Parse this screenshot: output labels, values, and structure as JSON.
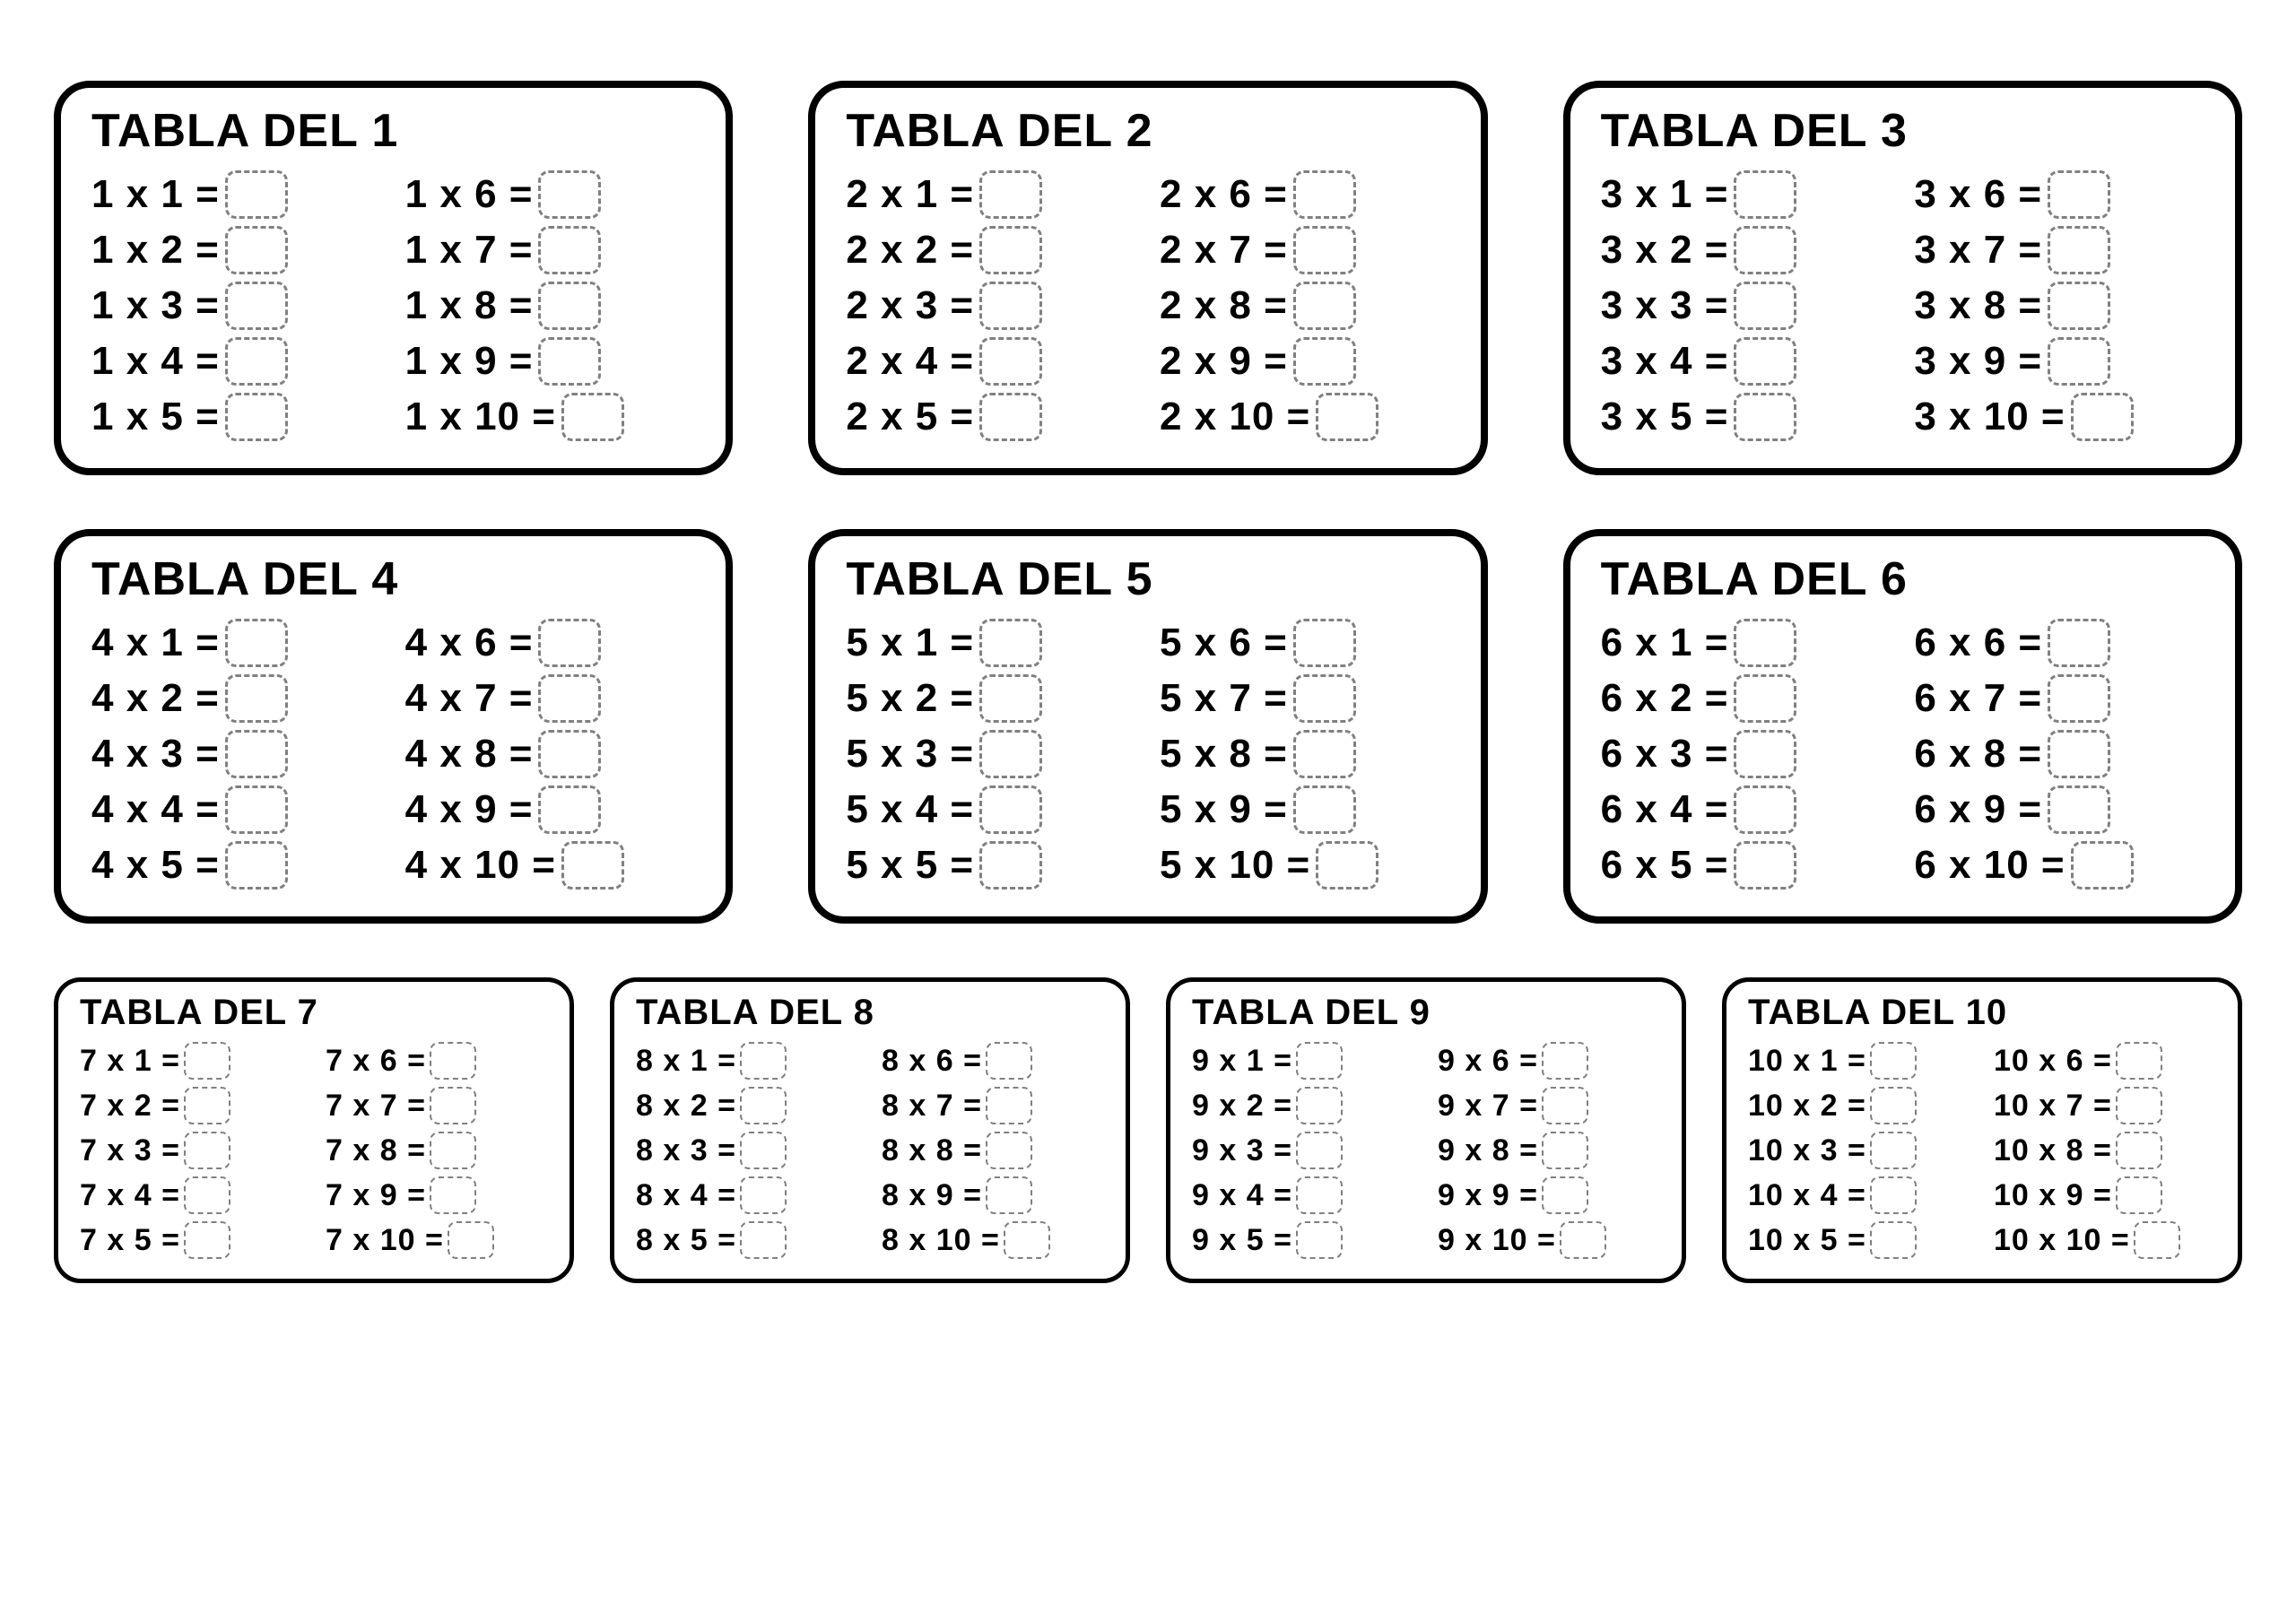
{
  "title_prefix": "TABLA DEL ",
  "times_symbol": " x ",
  "equals_symbol": " =",
  "tables": [
    {
      "n": 1,
      "size": "big"
    },
    {
      "n": 2,
      "size": "big"
    },
    {
      "n": 3,
      "size": "big"
    },
    {
      "n": 4,
      "size": "big"
    },
    {
      "n": 5,
      "size": "big"
    },
    {
      "n": 6,
      "size": "big"
    },
    {
      "n": 7,
      "size": "small"
    },
    {
      "n": 8,
      "size": "small"
    },
    {
      "n": 9,
      "size": "small"
    },
    {
      "n": 10,
      "size": "small"
    }
  ],
  "multipliers_left": [
    1,
    2,
    3,
    4,
    5
  ],
  "multipliers_right": [
    6,
    7,
    8,
    9,
    10
  ]
}
